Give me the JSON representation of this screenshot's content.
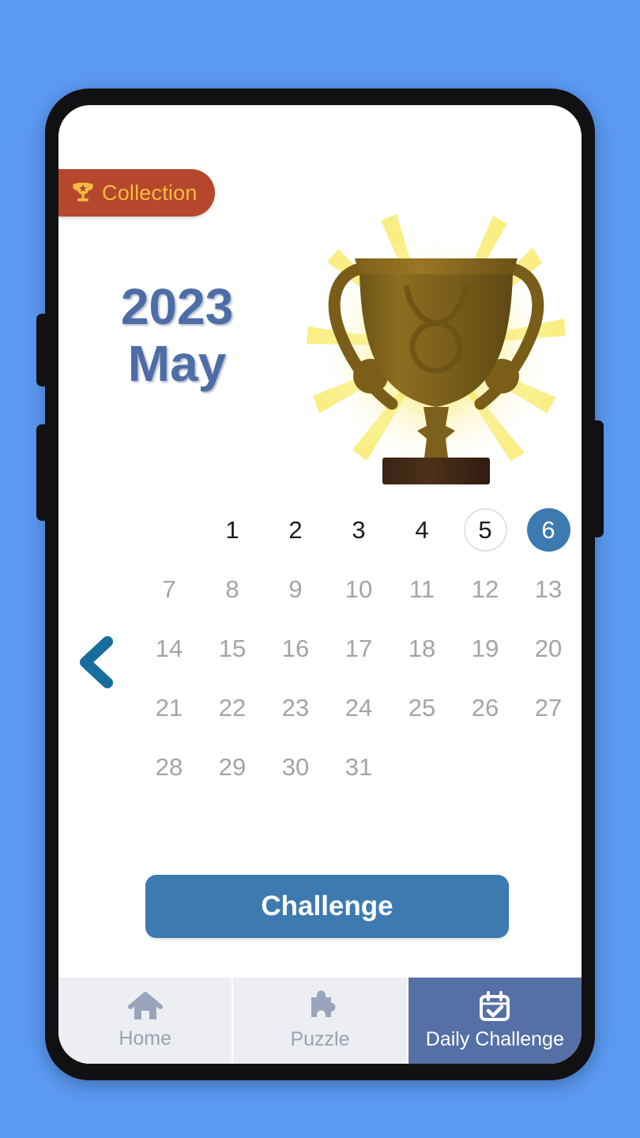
{
  "theme": {
    "page_background": "#5b9bf5",
    "phone_bezel": "#111113",
    "screen_background": "#ffffff",
    "accent_blue": "#3d7ab0",
    "heading_blue": "#4d6da6",
    "badge_background": "#b5472d",
    "badge_text": "#f5bc3f",
    "nav_inactive_background": "#eceef1",
    "nav_active_background": "#5570a6",
    "nav_inactive_text": "#9aa2b2",
    "day_disabled_text": "#a4a4a4",
    "day_past_text": "#1b1b1b",
    "trophy_gold": "#8a6a1f",
    "ray_yellow": "#f5e13c"
  },
  "collection_badge": {
    "label": "Collection",
    "icon": "trophy-icon"
  },
  "header": {
    "year": "2023",
    "month": "May"
  },
  "trophy": {
    "icon": "trophy-illustration",
    "zodiac_symbol": "taurus"
  },
  "navigation": {
    "prev_label": "",
    "prev_icon": "chevron-left-icon"
  },
  "calendar": {
    "leading_blanks": 1,
    "days": [
      {
        "number": "1",
        "state": "past"
      },
      {
        "number": "2",
        "state": "past"
      },
      {
        "number": "3",
        "state": "past"
      },
      {
        "number": "4",
        "state": "past"
      },
      {
        "number": "5",
        "state": "today"
      },
      {
        "number": "6",
        "state": "selected"
      },
      {
        "number": "7",
        "state": "future"
      },
      {
        "number": "8",
        "state": "future"
      },
      {
        "number": "9",
        "state": "future"
      },
      {
        "number": "10",
        "state": "future"
      },
      {
        "number": "11",
        "state": "future"
      },
      {
        "number": "12",
        "state": "future"
      },
      {
        "number": "13",
        "state": "future"
      },
      {
        "number": "14",
        "state": "future"
      },
      {
        "number": "15",
        "state": "future"
      },
      {
        "number": "16",
        "state": "future"
      },
      {
        "number": "17",
        "state": "future"
      },
      {
        "number": "18",
        "state": "future"
      },
      {
        "number": "19",
        "state": "future"
      },
      {
        "number": "20",
        "state": "future"
      },
      {
        "number": "21",
        "state": "future"
      },
      {
        "number": "22",
        "state": "future"
      },
      {
        "number": "23",
        "state": "future"
      },
      {
        "number": "24",
        "state": "future"
      },
      {
        "number": "25",
        "state": "future"
      },
      {
        "number": "26",
        "state": "future"
      },
      {
        "number": "27",
        "state": "future"
      },
      {
        "number": "28",
        "state": "future"
      },
      {
        "number": "29",
        "state": "future"
      },
      {
        "number": "30",
        "state": "future"
      },
      {
        "number": "31",
        "state": "future"
      }
    ]
  },
  "challenge_button": {
    "label": "Challenge"
  },
  "bottom_nav": {
    "tabs": [
      {
        "label": "Home",
        "icon": "house-icon",
        "active": false
      },
      {
        "label": "Puzzle",
        "icon": "puzzle-piece-icon",
        "active": false
      },
      {
        "label": "Daily Challenge",
        "icon": "calendar-check-icon",
        "active": true
      }
    ]
  }
}
